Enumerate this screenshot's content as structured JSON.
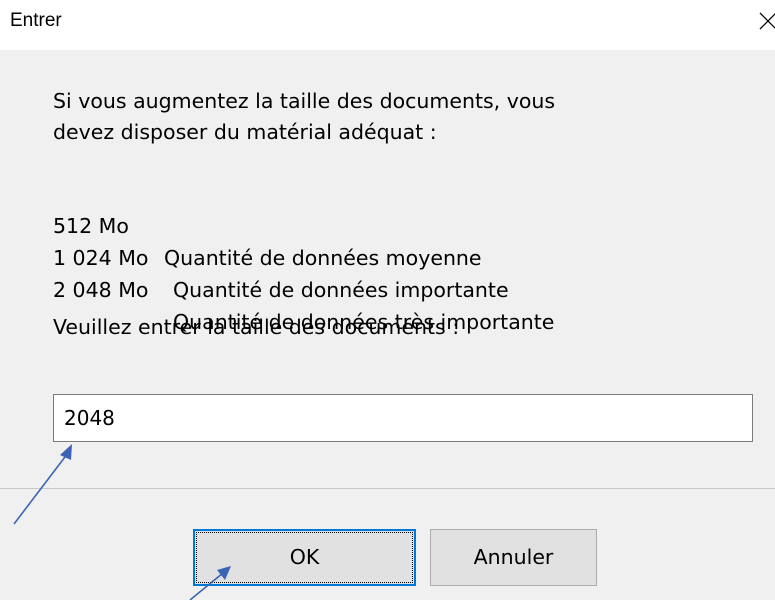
{
  "window": {
    "title": "Entrer",
    "close_icon": "close-icon"
  },
  "message": {
    "intro": "Si vous augmentez la taille des documents, vous\ndevez disposer du matérial adéquat :",
    "options": [
      {
        "size": "512 Mo",
        "description": "Quantité de données moyenne"
      },
      {
        "size": "1 024 Mo",
        "description": "Quantité de données importante"
      },
      {
        "size": "2 048 Mo",
        "description": "Quantité de données très importante"
      }
    ],
    "prompt": "Veuillez entrer la taille des documents :"
  },
  "input": {
    "value": "2048"
  },
  "buttons": {
    "ok_label": "OK",
    "cancel_label": "Annuler"
  },
  "colors": {
    "dialog_bg": "#f0f0f0",
    "focus_border": "#0078d7",
    "annotation_arrow": "#3c64b4"
  }
}
